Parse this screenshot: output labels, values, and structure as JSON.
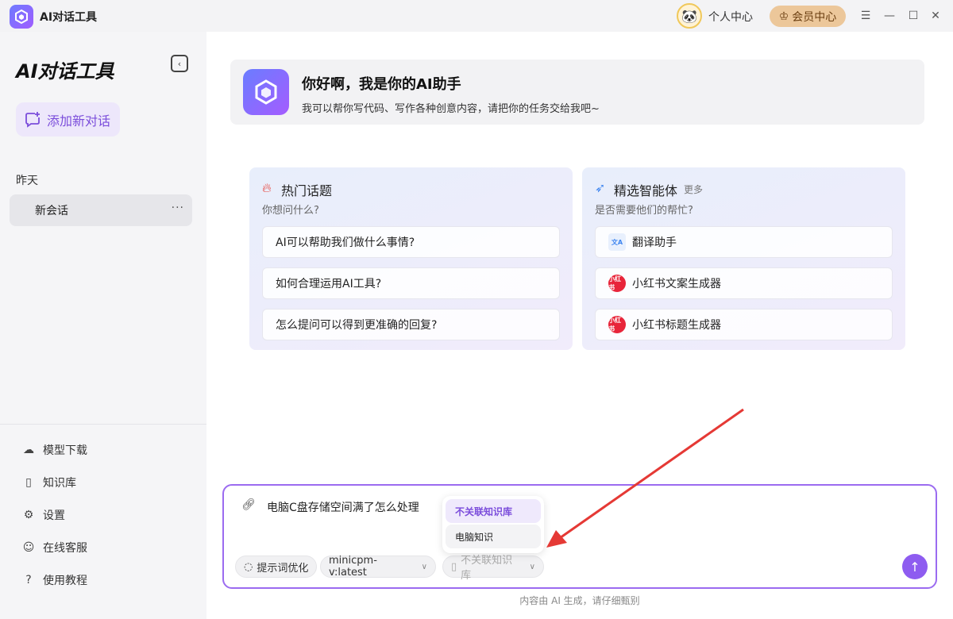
{
  "titlebar": {
    "app_title": "AI对话工具",
    "personal_center": "个人中心",
    "vip_center": "会员中心"
  },
  "sidebar": {
    "brand": "AI对话工具",
    "new_chat": "添加新对话",
    "section_label": "昨天",
    "conversations": [
      {
        "label": "新会话",
        "more": "···"
      }
    ],
    "nav": [
      {
        "label": "模型下载",
        "icon": "cloud-download-icon"
      },
      {
        "label": "知识库",
        "icon": "book-icon"
      },
      {
        "label": "设置",
        "icon": "gear-icon"
      },
      {
        "label": "在线客服",
        "icon": "user-icon"
      },
      {
        "label": "使用教程",
        "icon": "help-circle-icon"
      }
    ]
  },
  "welcome": {
    "title": "你好啊，我是你的AI助手",
    "subtitle": "我可以帮你写代码、写作各种创意内容，请把你的任务交给我吧~"
  },
  "hot_topics": {
    "title": "热门话题",
    "subtitle": "你想问什么?",
    "items": [
      "AI可以帮助我们做什么事情?",
      "如何合理运用AI工具?",
      "怎么提问可以得到更准确的回复?"
    ]
  },
  "agents": {
    "title": "精选智能体",
    "more": "更多",
    "subtitle": "是否需要他们的帮忙?",
    "items": [
      {
        "label": "翻译助手",
        "badge": "文A"
      },
      {
        "label": "小红书文案生成器",
        "badge": "小红书"
      },
      {
        "label": "小红书标题生成器",
        "badge": "小红书"
      }
    ]
  },
  "composer": {
    "text": "电脑C盘存储空间满了怎么处理",
    "prompt_optimize": "提示词优化",
    "model": "minicpm-v:latest",
    "knowledge_base": "不关联知识库"
  },
  "kb_dropdown": {
    "options": [
      "不关联知识库",
      "电脑知识"
    ]
  },
  "footer_note": "内容由 AI 生成，请仔细甄别",
  "colors": {
    "accent": "#8e5cf0",
    "vip": "#ecc79a",
    "annotation_arrow": "#e53935"
  }
}
